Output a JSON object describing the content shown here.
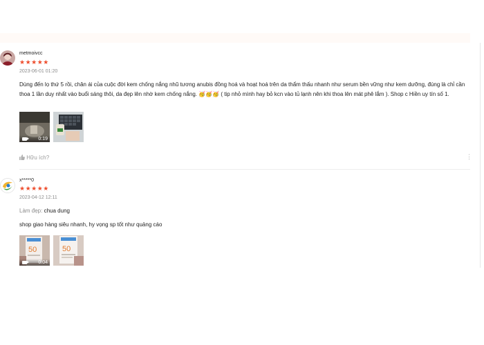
{
  "reviews": [
    {
      "username": "metmoivcc",
      "stars": "★★★★★",
      "datetime": "2023-06-01 01:20",
      "content": "Dùng đến lọ thứ 5 rồi, chân ái của cuộc đời kem chống nắng nhũ tương anubis đồng hoá và hoạt hoá trên da thẩm thấu nhanh như serum bền vững như kem dưỡng, đúng là chỉ cần thoa 1 lần duy nhất vào buổi sáng thôi, da đẹp lên nhờ kem chống nắng. 🥳🥳🥳 ( tip nhỏ mình hay bỏ kcn vào tủ lạnh nên khi thoa lên mát phê lắm ). Shop c Hiền uy tín số 1.",
      "video_duration": "0:19",
      "helpful_label": "Hữu ích?",
      "more_label": "⋮"
    },
    {
      "username": "x*****0",
      "stars": "★★★★★",
      "datetime": "2023-04-12 12:11",
      "attr_key": "Làm đẹp:",
      "attr_value": "chua dung",
      "content": "shop giao hàng siêu nhanh, hy vọng sp tốt như quảng cáo",
      "video_duration": "0:04"
    }
  ],
  "colors": {
    "star": "#ee4d2d",
    "muted": "#8a8a8a",
    "top_band": "#fffaf7"
  }
}
